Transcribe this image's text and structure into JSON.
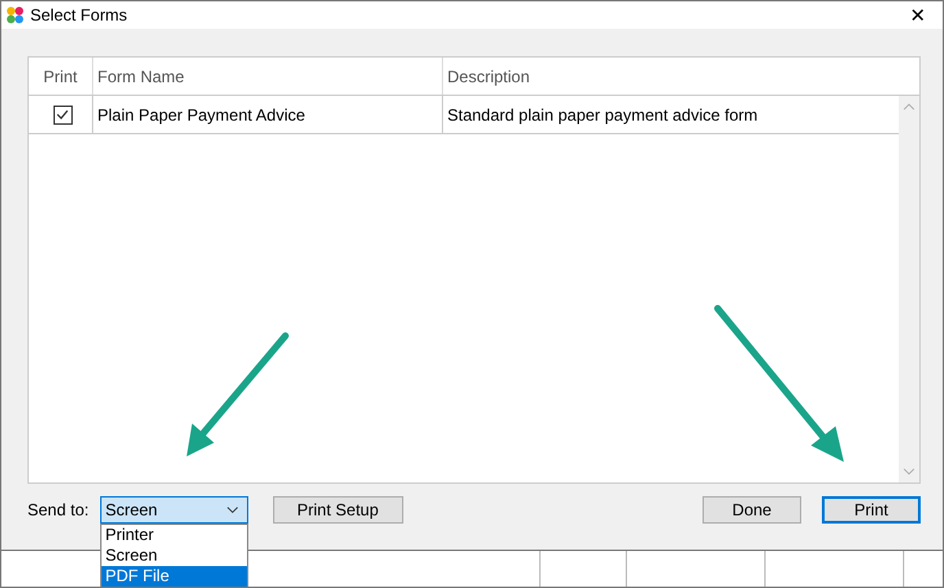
{
  "window": {
    "title": "Select Forms",
    "close": "✕"
  },
  "table": {
    "columns": [
      "Print",
      "Form Name",
      "Description"
    ],
    "rows": [
      {
        "checked": true,
        "name": "Plain Paper Payment Advice",
        "description": "Standard plain paper payment advice form"
      }
    ]
  },
  "send_to": {
    "label": "Send to:",
    "value": "Screen",
    "options": [
      {
        "label": "Printer",
        "highlighted": false
      },
      {
        "label": "Screen",
        "highlighted": false
      },
      {
        "label": "PDF File",
        "highlighted": true
      }
    ]
  },
  "buttons": [
    {
      "label": "Print Setup",
      "kind": "normal"
    },
    {
      "label": "Done",
      "kind": "normal"
    },
    {
      "label": "Print",
      "kind": "default"
    }
  ]
}
